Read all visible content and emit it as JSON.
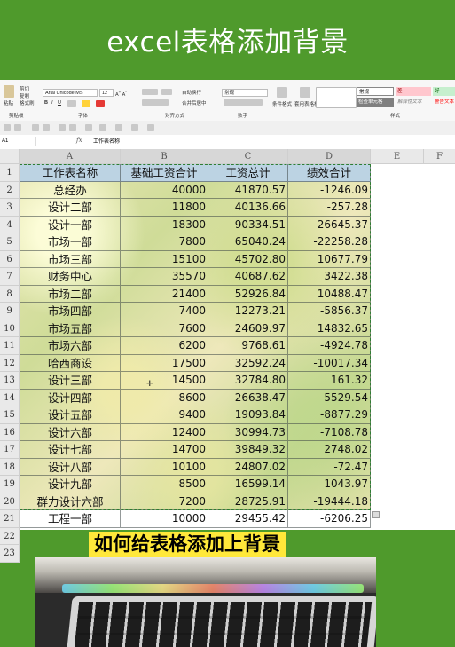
{
  "banner": {
    "title": "excel表格添加背景"
  },
  "ribbon": {
    "font_name": "Arial Unicode MS",
    "font_size": "12",
    "number_format": "常规",
    "groups": [
      "剪贴板",
      "字体",
      "对齐方式",
      "数字",
      "样式"
    ],
    "clipboard": {
      "paste": "粘贴",
      "cut": "剪切",
      "copy": "复制",
      "format_painter": "格式刷"
    },
    "align": {
      "wrap": "自动换行",
      "merge": "合并后居中"
    },
    "styles": {
      "cond_format": "条件格式",
      "table_format": "套用表格格式",
      "normal": "常规",
      "bad": "差",
      "good": "好",
      "calc": "计算",
      "check": "检查单元格",
      "explain": "解释性文本",
      "warn": "警告文本"
    }
  },
  "formula_bar": {
    "name_box": "A1",
    "fx": "fx",
    "value": "工作表名称"
  },
  "sheet": {
    "columns": [
      "A",
      "B",
      "C",
      "D",
      "E",
      "F"
    ],
    "rows": [
      "1",
      "2",
      "3",
      "4",
      "5",
      "6",
      "7",
      "8",
      "9",
      "10",
      "11",
      "12",
      "13",
      "14",
      "15",
      "16",
      "17",
      "18",
      "19",
      "20",
      "21",
      "22",
      "23"
    ],
    "headers": [
      "工作表名称",
      "基础工资合计",
      "工资总计",
      "绩效合计"
    ],
    "data": [
      [
        "总经办",
        "40000",
        "41870.57",
        "-1246.09"
      ],
      [
        "设计二部",
        "11800",
        "40136.66",
        "-257.28"
      ],
      [
        "设计一部",
        "18300",
        "90334.51",
        "-26645.37"
      ],
      [
        "市场一部",
        "7800",
        "65040.24",
        "-22258.28"
      ],
      [
        "市场三部",
        "15100",
        "45702.80",
        "10677.79"
      ],
      [
        "财务中心",
        "35570",
        "40687.62",
        "3422.38"
      ],
      [
        "市场二部",
        "21400",
        "52926.84",
        "10488.47"
      ],
      [
        "市场四部",
        "7400",
        "12273.21",
        "-5856.37"
      ],
      [
        "市场五部",
        "7600",
        "24609.97",
        "14832.65"
      ],
      [
        "市场六部",
        "6200",
        "9768.61",
        "-4924.78"
      ],
      [
        "哈西商设",
        "17500",
        "32592.24",
        "-10017.34"
      ],
      [
        "设计三部",
        "14500",
        "32784.80",
        "161.32"
      ],
      [
        "设计四部",
        "8600",
        "26638.47",
        "5529.54"
      ],
      [
        "设计五部",
        "9400",
        "19093.84",
        "-8877.29"
      ],
      [
        "设计六部",
        "12400",
        "30994.73",
        "-7108.78"
      ],
      [
        "设计七部",
        "14700",
        "39849.32",
        "2748.02"
      ],
      [
        "设计八部",
        "10100",
        "24807.02",
        "-72.47"
      ],
      [
        "设计九部",
        "8500",
        "16599.14",
        "1043.97"
      ],
      [
        "群力设计六部",
        "7200",
        "28725.91",
        "-19444.18"
      ],
      [
        "工程一部",
        "10000",
        "29455.42",
        "-6206.25"
      ]
    ]
  },
  "caption": "如何给表格添加上背景",
  "colors": {
    "banner": "#4f9a2c",
    "caption_bg": "#ffe83a",
    "header_fill": "#bcd3e3",
    "marquee": "#2e7d32"
  }
}
